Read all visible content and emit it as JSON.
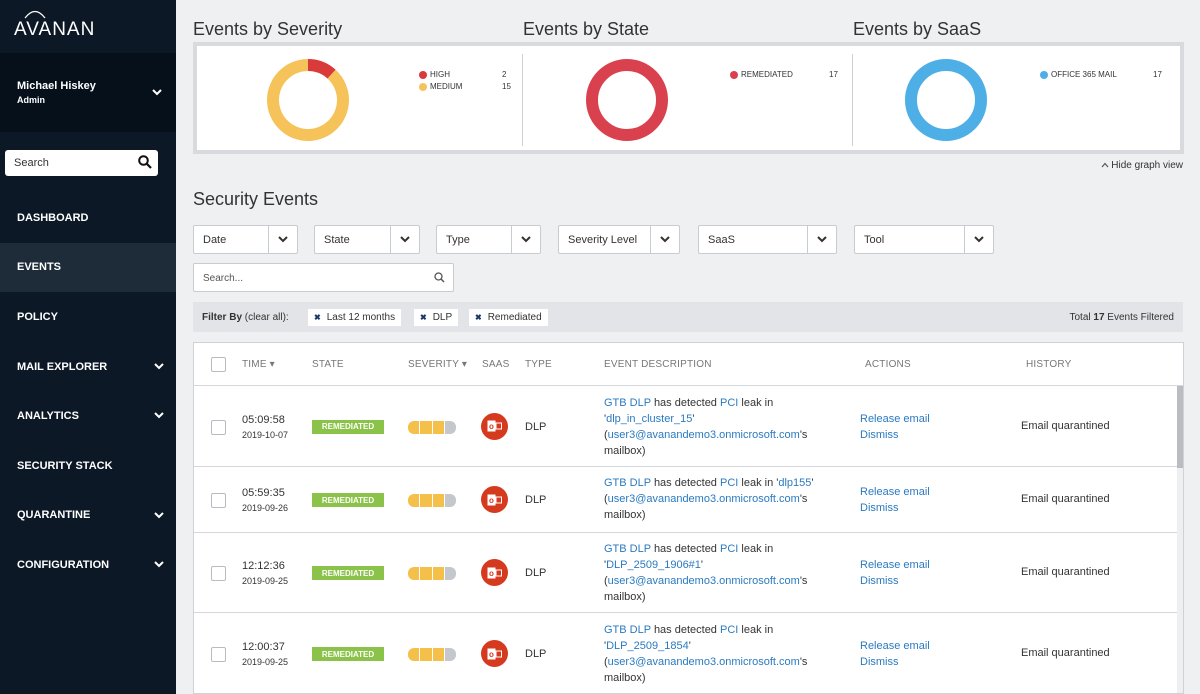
{
  "brand": {
    "logo_text": "AVANAN"
  },
  "user": {
    "name": "Michael Hiskey",
    "role": "Admin"
  },
  "sidebar": {
    "search_label": "Search",
    "items": [
      {
        "label": "DASHBOARD",
        "active": false,
        "has_chevron": false
      },
      {
        "label": "EVENTS",
        "active": true,
        "has_chevron": false
      },
      {
        "label": "POLICY",
        "active": false,
        "has_chevron": false
      },
      {
        "label": "MAIL EXPLORER",
        "active": false,
        "has_chevron": true
      },
      {
        "label": "ANALYTICS",
        "active": false,
        "has_chevron": true
      },
      {
        "label": "SECURITY STACK",
        "active": false,
        "has_chevron": false
      },
      {
        "label": "QUARANTINE",
        "active": false,
        "has_chevron": true
      },
      {
        "label": "CONFIGURATION",
        "active": false,
        "has_chevron": true
      }
    ]
  },
  "charts": {
    "severity": {
      "title": "Events by Severity",
      "legend": [
        {
          "label": "HIGH",
          "value": "2",
          "color": "#d93a3a"
        },
        {
          "label": "MEDIUM",
          "value": "15",
          "color": "#f5c35a"
        }
      ]
    },
    "state": {
      "title": "Events by State",
      "legend": [
        {
          "label": "REMEDIATED",
          "value": "17",
          "color": "#d9414e"
        }
      ]
    },
    "saas": {
      "title": "Events by SaaS",
      "legend": [
        {
          "label": "OFFICE 365 MAIL",
          "value": "17",
          "color": "#4eaee6"
        }
      ]
    },
    "hide_label": "Hide graph view"
  },
  "chart_data": [
    {
      "type": "pie",
      "categories": [
        "HIGH",
        "MEDIUM"
      ],
      "values": [
        2,
        15
      ],
      "colors": [
        "#d93a3a",
        "#f5c35a"
      ]
    },
    {
      "type": "pie",
      "categories": [
        "REMEDIATED"
      ],
      "values": [
        17
      ],
      "colors": [
        "#d9414e"
      ]
    },
    {
      "type": "pie",
      "categories": [
        "OFFICE 365 MAIL"
      ],
      "values": [
        17
      ],
      "colors": [
        "#4eaee6"
      ]
    }
  ],
  "events": {
    "title": "Security Events",
    "filters": [
      "Date",
      "State",
      "Type",
      "Severity Level",
      "SaaS",
      "Tool"
    ],
    "search_placeholder": "Search...",
    "filter_by_label": "Filter By",
    "clear_all": "(clear all):",
    "chips": [
      "Last 12 months",
      "DLP",
      "Remediated"
    ],
    "total_prefix": "Total",
    "total_count": "17",
    "total_suffix": "Events Filtered"
  },
  "table": {
    "headers": {
      "time": "TIME",
      "state": "STATE",
      "severity": "SEVERITY",
      "saas": "SAAS",
      "type": "TYPE",
      "description": "EVENT DESCRIPTION",
      "actions": "ACTIONS",
      "history": "HISTORY"
    },
    "rows": [
      {
        "time": "05:09:58",
        "date": "2019-10-07",
        "state": "REMEDIATED",
        "type": "DLP",
        "tool": "GTB DLP",
        "detected": "has detected",
        "leak_type": "PCI",
        "leak_in": "leak in",
        "quote_open": "'",
        "object": "dlp_in_cluster_15",
        "quote_close": "'",
        "paren_open": "(",
        "mailbox_user": "user3@avanandemo3.onmicrosoft.com",
        "mailbox_suffix": "'s mailbox)",
        "action1": "Release email",
        "action2": "Dismiss",
        "history": "Email quarantined",
        "severity_level": 3
      },
      {
        "time": "05:59:35",
        "date": "2019-09-26",
        "state": "REMEDIATED",
        "type": "DLP",
        "tool": "GTB DLP",
        "detected": "has detected",
        "leak_type": "PCI",
        "leak_in": "leak in",
        "quote_open": "'",
        "object": "dlp155",
        "quote_close": "'",
        "paren_open": "(",
        "mailbox_user": "user3@avanandemo3.onmicrosoft.com",
        "mailbox_suffix": "'s mailbox)",
        "action1": "Release email",
        "action2": "Dismiss",
        "history": "Email quarantined",
        "severity_level": 3
      },
      {
        "time": "12:12:36",
        "date": "2019-09-25",
        "state": "REMEDIATED",
        "type": "DLP",
        "tool": "GTB DLP",
        "detected": "has detected",
        "leak_type": "PCI",
        "leak_in": "leak in",
        "quote_open": "'",
        "object": "DLP_2509_1906#1",
        "quote_close": "'",
        "paren_open": "(",
        "mailbox_user": "user3@avanandemo3.onmicrosoft.com",
        "mailbox_suffix": "'s mailbox)",
        "action1": "Release email",
        "action2": "Dismiss",
        "history": "Email quarantined",
        "severity_level": 3
      },
      {
        "time": "12:00:37",
        "date": "2019-09-25",
        "state": "REMEDIATED",
        "type": "DLP",
        "tool": "GTB DLP",
        "detected": "has detected",
        "leak_type": "PCI",
        "leak_in": "leak in",
        "quote_open": "'",
        "object": "DLP_2509_1854",
        "quote_close": "'",
        "paren_open": "(",
        "mailbox_user": "user3@avanandemo3.onmicrosoft.com",
        "mailbox_suffix": "'s mailbox)",
        "action1": "Release email",
        "action2": "Dismiss",
        "history": "Email quarantined",
        "severity_level": 3
      }
    ]
  }
}
